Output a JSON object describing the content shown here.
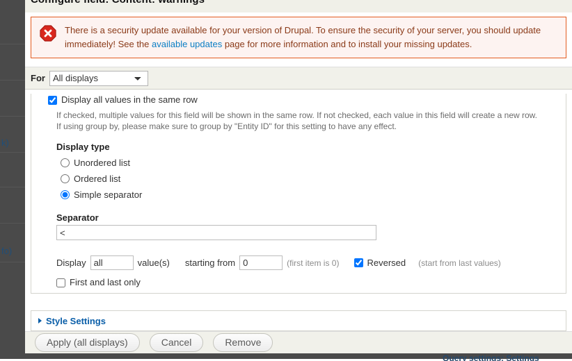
{
  "window": {
    "title": "Configure field: Content: warnings"
  },
  "backdrop": {
    "rows": [
      {
        "text": ""
      },
      {
        "text": ""
      },
      {
        "text": ""
      },
      {
        "text": "k)"
      },
      {
        "text": ""
      },
      {
        "text": ""
      },
      {
        "text": "fo)"
      },
      {
        "text": ""
      }
    ],
    "bottom_text": "Query settings: Settings"
  },
  "message": {
    "icon": "error-octagon-icon",
    "text_before_link": "There is a security update available for your version of Drupal. To ensure the security of your server, you should update immediately! See the ",
    "link_text": "available updates",
    "text_after_link": " page for more information and to install your missing updates.",
    "border_color": "#e35b20",
    "background_color": "#fdf3f1",
    "text_color": "#8a3a18",
    "link_color": "#0a7ec4"
  },
  "display_selector": {
    "label": "For",
    "selected": "All displays",
    "options": [
      "All displays"
    ]
  },
  "form": {
    "same_row_checkbox": {
      "label": "Display all values in the same row",
      "checked": true
    },
    "description": "If checked, multiple values for this field will be shown in the same row. If not checked, each value in this field will create a new row. If using group by, please make sure to group by \"Entity ID\" for this setting to have any effect.",
    "display_type": {
      "legend": "Display type",
      "options": [
        {
          "label": "Unordered list",
          "selected": false
        },
        {
          "label": "Ordered list",
          "selected": false
        },
        {
          "label": "Simple separator",
          "selected": true
        }
      ]
    },
    "separator": {
      "label": "Separator",
      "value": "<"
    },
    "display_values": {
      "prefix_label": "Display",
      "count_value": "all",
      "middle_label": "value(s)",
      "starting_label": "starting from",
      "offset_value": "0",
      "offset_hint": "(first item is 0)",
      "reversed_label": "Reversed",
      "reversed_checked": true,
      "reversed_hint": "(start from last values)"
    },
    "first_and_last": {
      "label": "First and last only",
      "checked": false
    }
  },
  "style_settings": {
    "label": "Style Settings",
    "expanded": false,
    "link_color": "#0a5ea8"
  },
  "buttons": {
    "apply": "Apply (all displays)",
    "cancel": "Cancel",
    "remove": "Remove"
  }
}
